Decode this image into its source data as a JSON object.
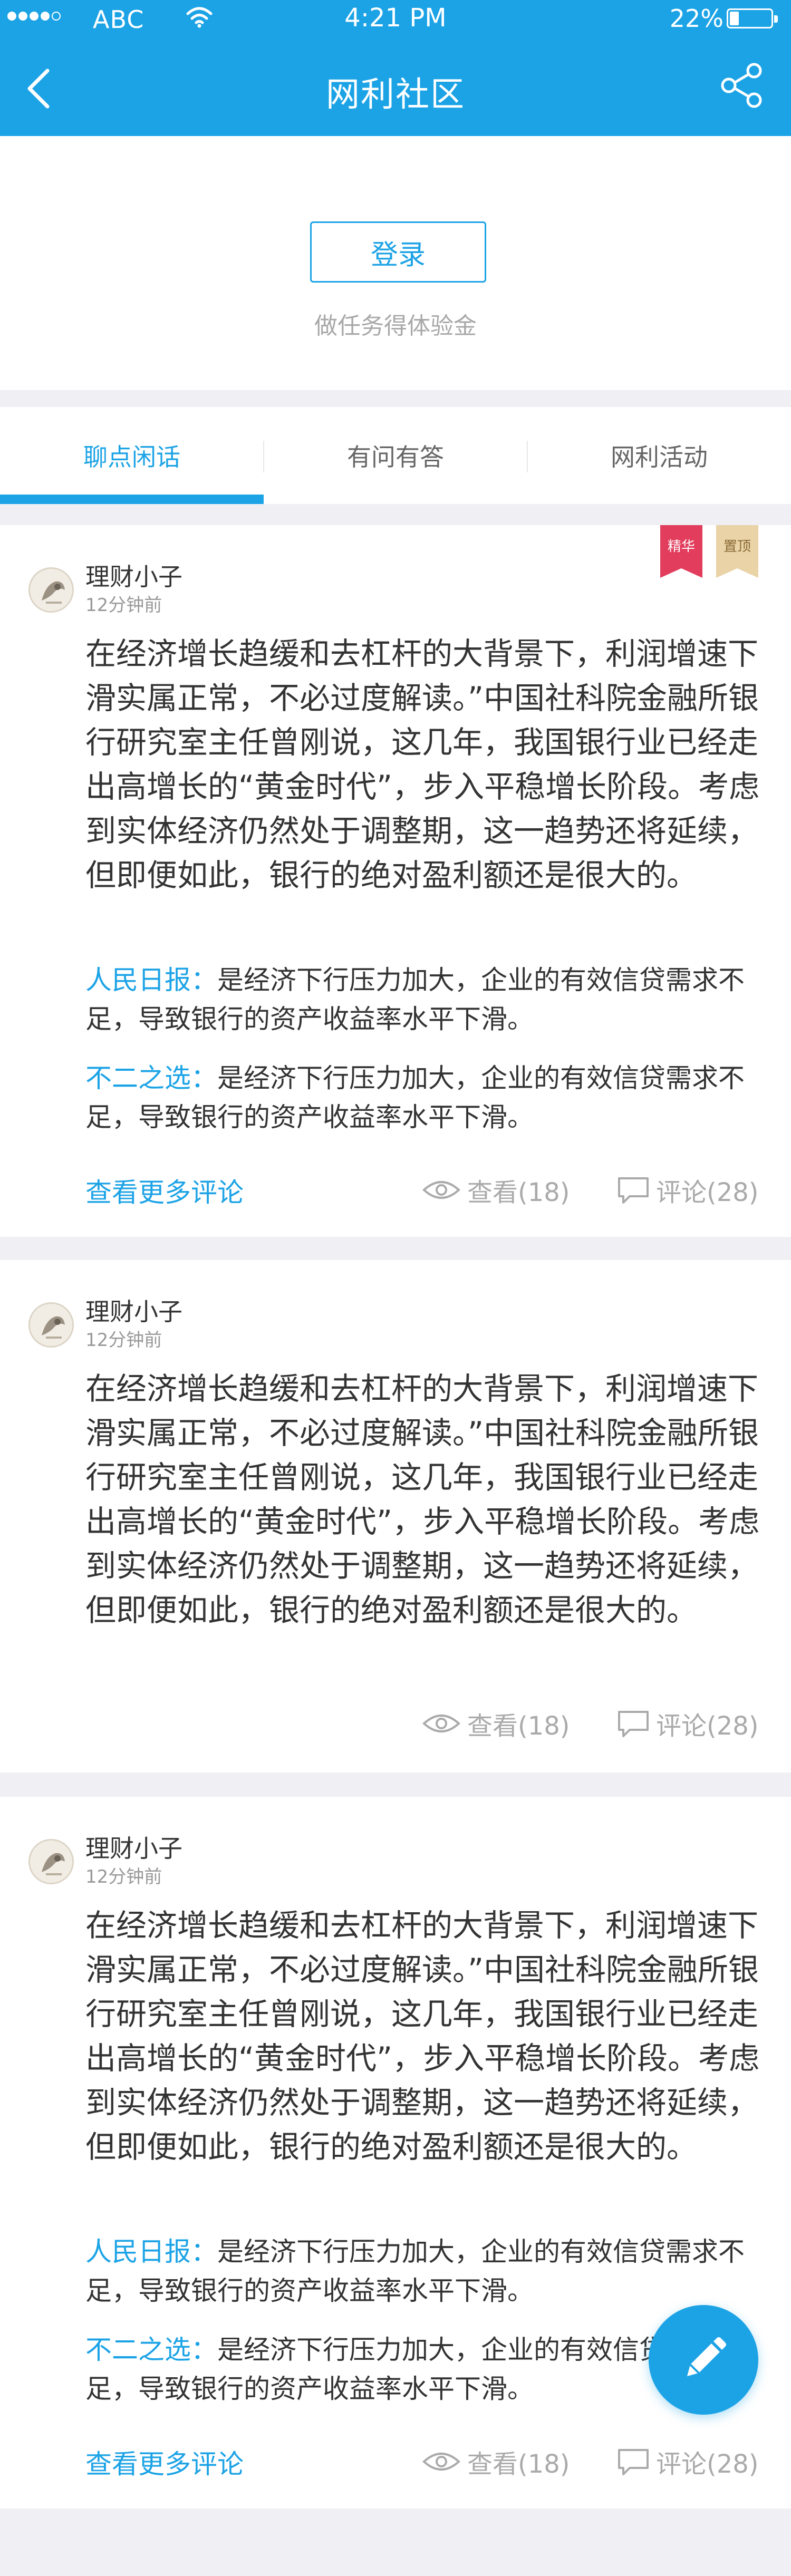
{
  "status": {
    "carrier": "ABC",
    "time": "4:21 PM",
    "battery": "22%",
    "battery_level": 0.22
  },
  "nav": {
    "title": "网利社区",
    "back_icon": "chevron-left-icon",
    "share_icon": "share-icon"
  },
  "login": {
    "button_label": "登录",
    "tip": "做任务得体验金"
  },
  "tabs": [
    {
      "label": "聊点闲话",
      "active": true
    },
    {
      "label": "有问有答",
      "active": false
    },
    {
      "label": "网利活动",
      "active": false
    }
  ],
  "posts": [
    {
      "author": "理财小子",
      "time": "12分钟前",
      "badges": [
        "精华",
        "置顶"
      ],
      "text": "在经济增长趋缓和去杠杆的大背景下，利润增速下滑实属正常，不必过度解读。”中国社科院金融所银行研究室主任曾刚说，这几年，我国银行业已经走出高增长的“黄金时代”，步入平稳增长阶段。考虑到实体经济仍然处于调整期，这一趋势还将延续，但即便如此，银行的绝对盈利额还是很大的。",
      "comments": [
        {
          "name": "人民日报：",
          "text": "是经济下行压力加大，企业的有效信贷需求不足，导致银行的资产收益率水平下滑。"
        },
        {
          "name": "不二之选：",
          "text": "是经济下行压力加大，企业的有效信贷需求不足，导致银行的资产收益率水平下滑。"
        }
      ],
      "more_label": "查看更多评论",
      "views": "查看(18)",
      "replies": "评论(28)"
    },
    {
      "author": "理财小子",
      "time": "12分钟前",
      "text": "在经济增长趋缓和去杠杆的大背景下，利润增速下滑实属正常，不必过度解读。”中国社科院金融所银行研究室主任曾刚说，这几年，我国银行业已经走出高增长的“黄金时代”，步入平稳增长阶段。考虑到实体经济仍然处于调整期，这一趋势还将延续，但即便如此，银行的绝对盈利额还是很大的。",
      "views": "查看(18)",
      "replies": "评论(28)"
    },
    {
      "author": "理财小子",
      "time": "12分钟前",
      "text": "在经济增长趋缓和去杠杆的大背景下，利润增速下滑实属正常，不必过度解读。”中国社科院金融所银行研究室主任曾刚说，这几年，我国银行业已经走出高增长的“黄金时代”，步入平稳增长阶段。考虑到实体经济仍然处于调整期，这一趋势还将延续，但即便如此，银行的绝对盈利额还是很大的。",
      "comments": [
        {
          "name": "人民日报：",
          "text": "是经济下行压力加大，企业的有效信贷需求不足，导致银行的资产收益率水平下滑。"
        },
        {
          "name": "不二之选：",
          "text": "是经济下行压力加大，企业的有效信贷需求不足，导致银行的资产收益率水平下滑。"
        }
      ],
      "more_label": "查看更多评论",
      "views": "查看(18)",
      "replies": "评论(28)"
    }
  ],
  "fab_icon": "pencil-icon",
  "colors": {
    "accent": "#1ca3e6",
    "badge_featured": "#e23d5c",
    "badge_pinned": "#e9d3a7",
    "background": "#efeff4"
  }
}
